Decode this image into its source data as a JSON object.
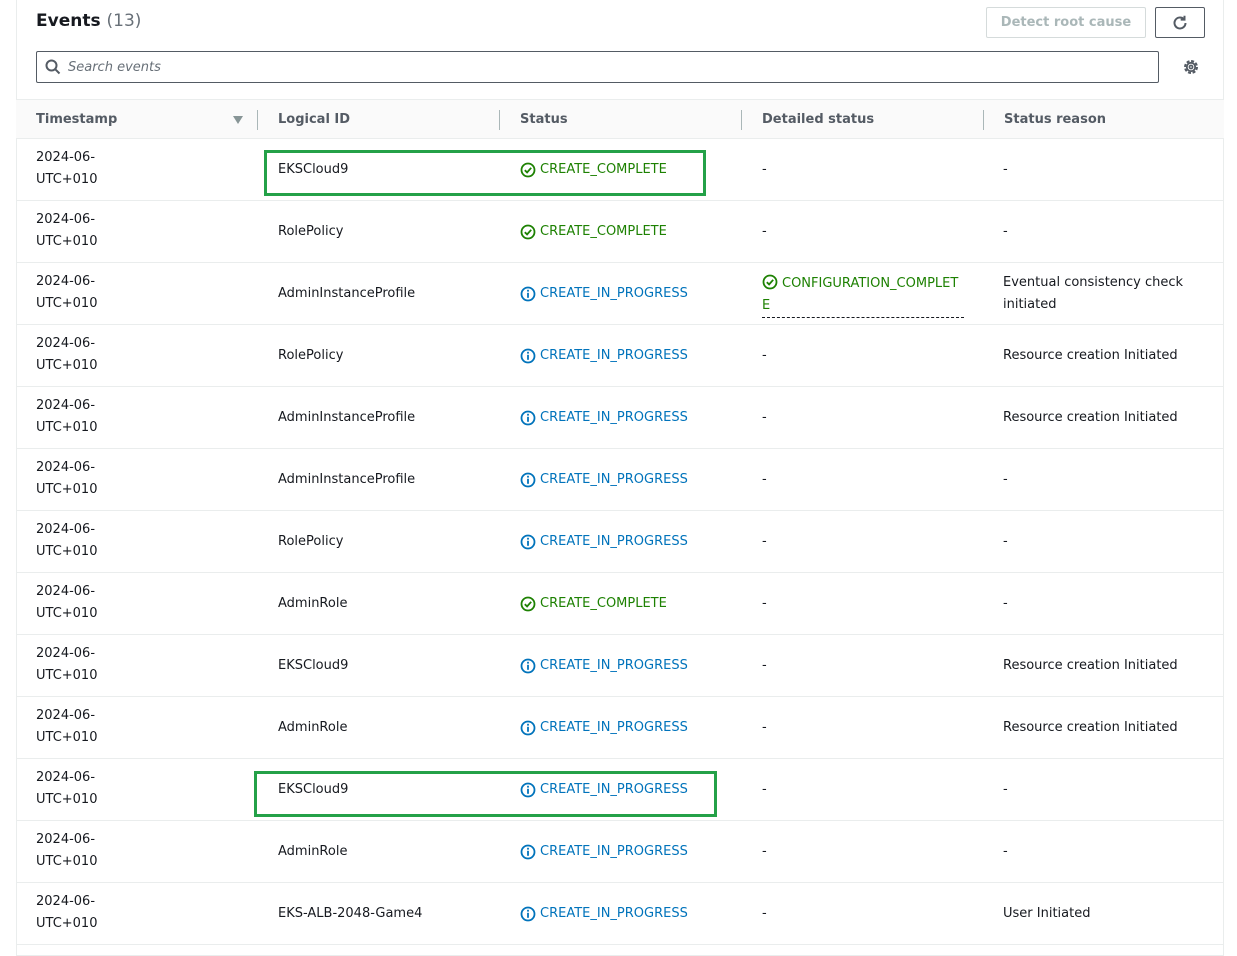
{
  "header": {
    "title": "Events",
    "count": "(13)",
    "detect_label": "Detect root cause"
  },
  "search": {
    "placeholder": "Search events"
  },
  "columns": [
    "Timestamp",
    "Logical ID",
    "Status",
    "Detailed status",
    "Status reason"
  ],
  "colors": {
    "complete": "#1d8102",
    "in_progress": "#0073bb",
    "highlight": "#24a148"
  },
  "rows": [
    {
      "ts1": "2024-06-",
      "ts2": "UTC+0100",
      "logical_id": "EKSCloud9",
      "status": "CREATE_COMPLETE",
      "status_type": "complete",
      "detailed": "-",
      "reason": "-"
    },
    {
      "ts1": "2024-06-",
      "ts2": "UTC+0100",
      "logical_id": "RolePolicy",
      "status": "CREATE_COMPLETE",
      "status_type": "complete",
      "detailed": "-",
      "reason": "-"
    },
    {
      "ts1": "2024-06-",
      "ts2": "UTC+0100",
      "logical_id": "AdminInstanceProfile",
      "status": "CREATE_IN_PROGRESS",
      "status_type": "in_progress",
      "detailed": "CONFIGURATION_COMPLETE",
      "detailed_type": "complete",
      "reason": "Eventual consistency check initiated"
    },
    {
      "ts1": "2024-06-",
      "ts2": "UTC+0100",
      "logical_id": "RolePolicy",
      "status": "CREATE_IN_PROGRESS",
      "status_type": "in_progress",
      "detailed": "-",
      "reason": "Resource creation Initiated"
    },
    {
      "ts1": "2024-06-",
      "ts2": "UTC+0100",
      "logical_id": "AdminInstanceProfile",
      "status": "CREATE_IN_PROGRESS",
      "status_type": "in_progress",
      "detailed": "-",
      "reason": "Resource creation Initiated"
    },
    {
      "ts1": "2024-06-",
      "ts2": "UTC+0100",
      "logical_id": "AdminInstanceProfile",
      "status": "CREATE_IN_PROGRESS",
      "status_type": "in_progress",
      "detailed": "-",
      "reason": "-"
    },
    {
      "ts1": "2024-06-",
      "ts2": "UTC+0100",
      "logical_id": "RolePolicy",
      "status": "CREATE_IN_PROGRESS",
      "status_type": "in_progress",
      "detailed": "-",
      "reason": "-"
    },
    {
      "ts1": "2024-06-",
      "ts2": "UTC+0100",
      "logical_id": "AdminRole",
      "status": "CREATE_COMPLETE",
      "status_type": "complete",
      "detailed": "-",
      "reason": "-"
    },
    {
      "ts1": "2024-06-",
      "ts2": "UTC+0100",
      "logical_id": "EKSCloud9",
      "status": "CREATE_IN_PROGRESS",
      "status_type": "in_progress",
      "detailed": "-",
      "reason": "Resource creation Initiated"
    },
    {
      "ts1": "2024-06-",
      "ts2": "UTC+0100",
      "logical_id": "AdminRole",
      "status": "CREATE_IN_PROGRESS",
      "status_type": "in_progress",
      "detailed": "-",
      "reason": "Resource creation Initiated"
    },
    {
      "ts1": "2024-06-",
      "ts2": "UTC+0100",
      "logical_id": "EKSCloud9",
      "status": "CREATE_IN_PROGRESS",
      "status_type": "in_progress",
      "detailed": "-",
      "reason": "-"
    },
    {
      "ts1": "2024-06-",
      "ts2": "UTC+0100",
      "logical_id": "AdminRole",
      "status": "CREATE_IN_PROGRESS",
      "status_type": "in_progress",
      "detailed": "-",
      "reason": "-"
    },
    {
      "ts1": "2024-06-",
      "ts2": "UTC+0100",
      "logical_id": "EKS-ALB-2048-Game4",
      "status": "CREATE_IN_PROGRESS",
      "status_type": "in_progress",
      "detailed": "-",
      "reason": "User Initiated"
    }
  ]
}
